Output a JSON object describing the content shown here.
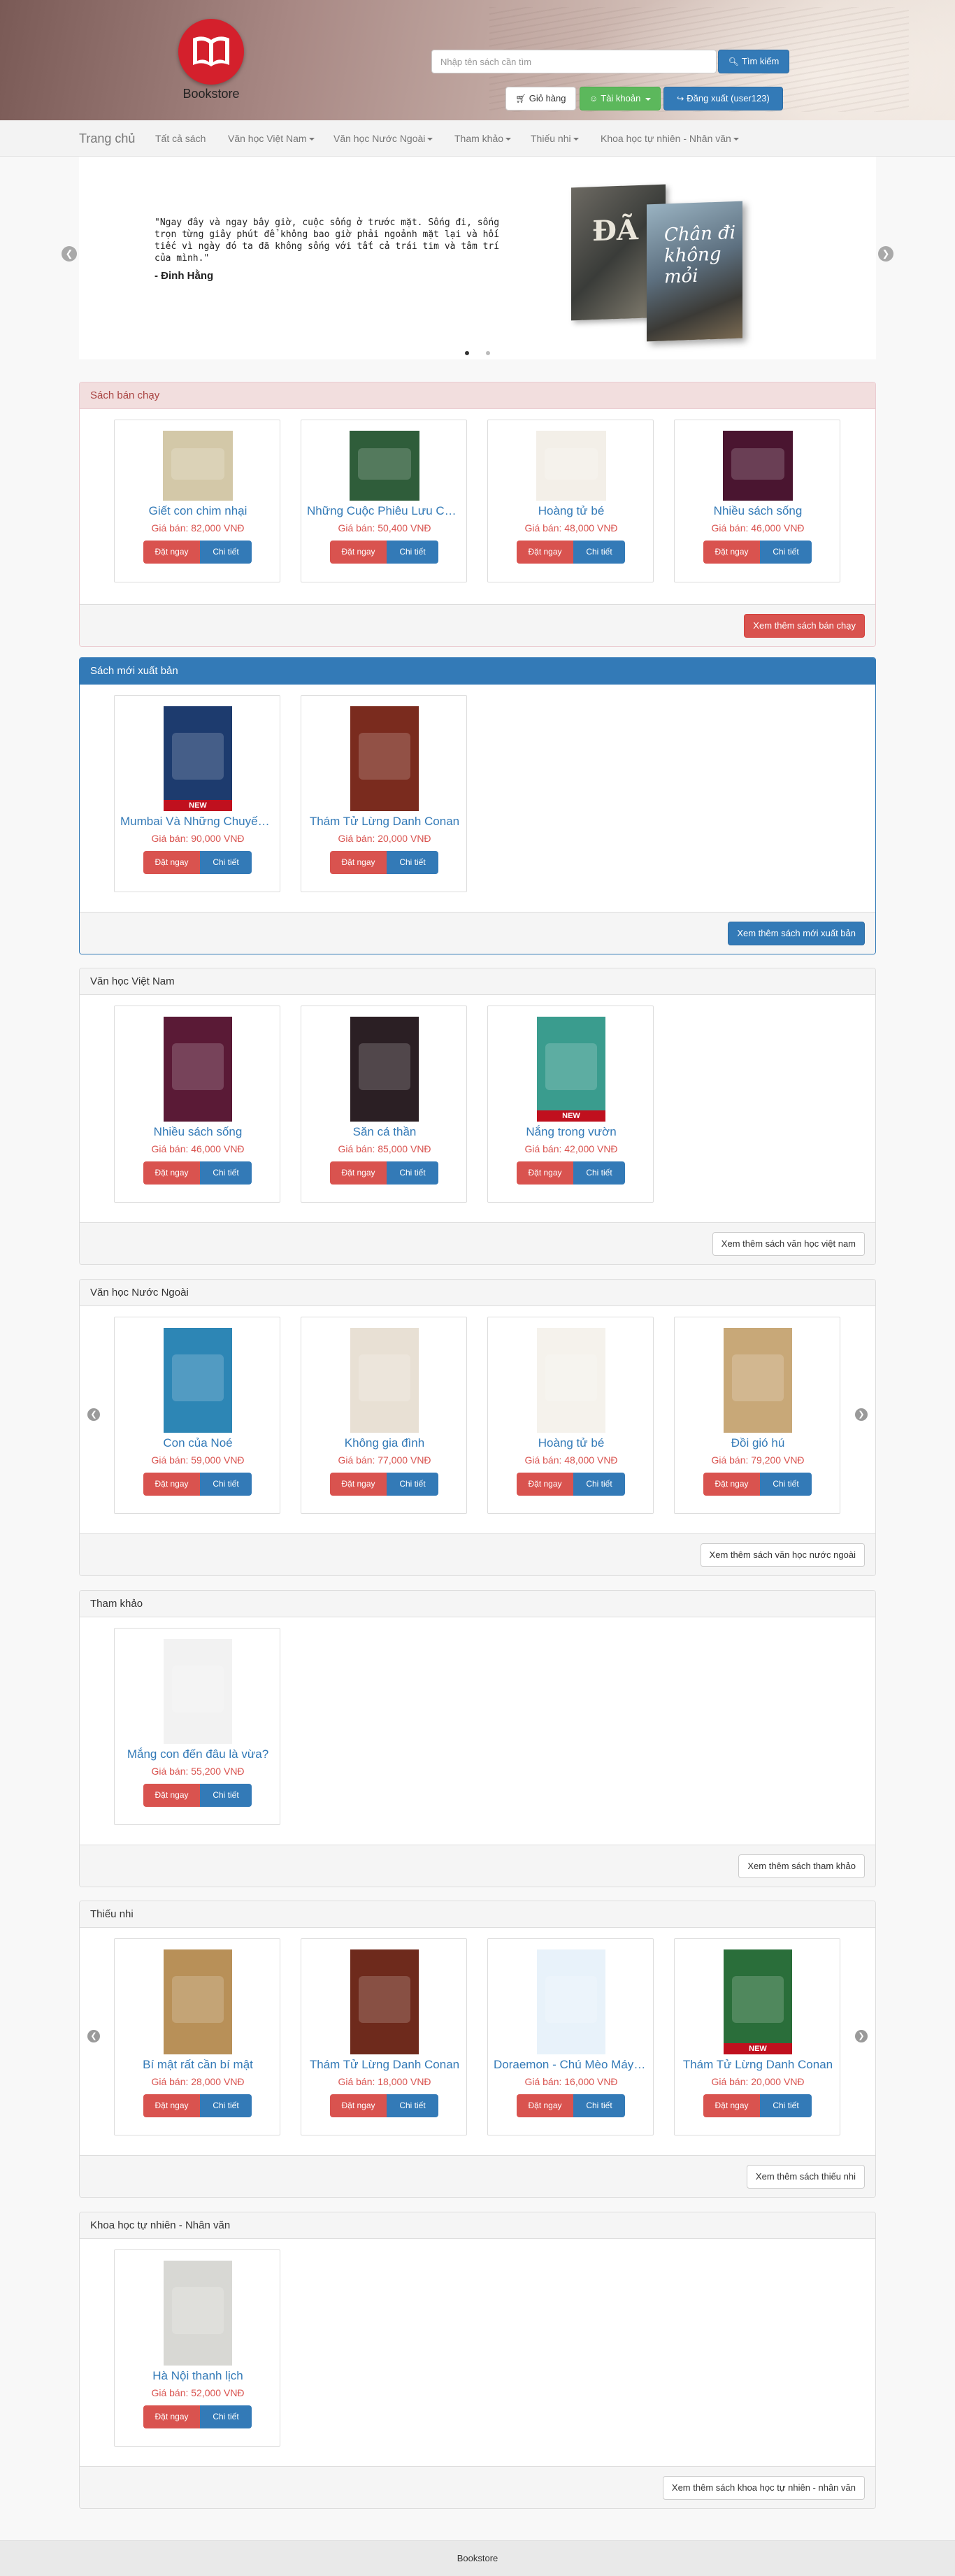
{
  "brand": {
    "name": "Bookstore"
  },
  "header": {
    "search_placeholder": "Nhập tên sách cần tìm",
    "search_button": "Tìm kiếm",
    "cart_button": "Giỏ hàng",
    "account_button": "Tài khoản",
    "logout_button": "Đăng xuất (user123)"
  },
  "nav": {
    "home": "Trang chủ",
    "items": [
      {
        "label": "Tất cả sách",
        "dropdown": false
      },
      {
        "label": "Văn học Việt Nam",
        "dropdown": true
      },
      {
        "label": "Văn học Nước Ngoài",
        "dropdown": true
      },
      {
        "label": "Tham khảo",
        "dropdown": true
      },
      {
        "label": "Thiếu nhi",
        "dropdown": true
      },
      {
        "label": "Khoa học tự nhiên - Nhân văn",
        "dropdown": true
      }
    ]
  },
  "carousel": {
    "quote": "\"Ngay đây và ngay bây giờ, cuộc sống ở trước mặt. Sống đi, sống trọn từng giây phút để không bao giờ phải ngoảnh mặt lại và hối tiếc vì ngày đó ta đã không sống với tất cả trái tim và tâm trí của mình.\"",
    "author": "- Đinh Hằng",
    "book1_title": "ĐÃ",
    "book2_title": "Chân đi không mỏi",
    "slides": 2,
    "active_slide": 1
  },
  "sections": [
    {
      "title": "Sách bán chạy",
      "style": "danger",
      "more": "Xem thêm sách bán chạy",
      "arrows": false,
      "books": [
        {
          "title": "Giết con chim nhại",
          "price": "Giá bán: 82,000 VNĐ",
          "cover": "#d3c8a8",
          "new": false,
          "tall": false
        },
        {
          "title": "Những Cuộc Phiêu Lưu Của Huckleberry Finn",
          "price": "Giá bán: 50,400 VNĐ",
          "cover": "#2f5d3a",
          "new": false,
          "tall": false
        },
        {
          "title": "Hoàng tử bé",
          "price": "Giá bán: 48,000 VNĐ",
          "cover": "#f3efe8",
          "new": false,
          "tall": false
        },
        {
          "title": "Nhiều sách sống",
          "price": "Giá bán: 46,000 VNĐ",
          "cover": "#4a1530",
          "new": false,
          "tall": false
        }
      ]
    },
    {
      "title": "Sách mới xuất bản",
      "style": "primary",
      "more": "Xem thêm sách mới xuất bản",
      "arrows": false,
      "books": [
        {
          "title": "Mumbai Và Những Chuyến Phiêu Lưu",
          "price": "Giá bán: 90,000 VNĐ",
          "cover": "#1d3b6e",
          "new": true,
          "tall": true
        },
        {
          "title": "Thám Tử Lừng Danh Conan",
          "price": "Giá bán: 20,000 VNĐ",
          "cover": "#7a2b1e",
          "new": false,
          "tall": true
        }
      ]
    },
    {
      "title": "Văn học Việt Nam",
      "style": "default",
      "more": "Xem thêm sách văn học việt nam",
      "arrows": false,
      "books": [
        {
          "title": "Nhiều sách sống",
          "price": "Giá bán: 46,000 VNĐ",
          "cover": "#5a1a36",
          "new": false,
          "tall": true
        },
        {
          "title": "Săn cá thần",
          "price": "Giá bán: 85,000 VNĐ",
          "cover": "#2b1f24",
          "new": false,
          "tall": true
        },
        {
          "title": "Nắng trong vườn",
          "price": "Giá bán: 42,000 VNĐ",
          "cover": "#3a9c8e",
          "new": true,
          "tall": true
        }
      ]
    },
    {
      "title": "Văn học Nước Ngoài",
      "style": "default",
      "more": "Xem thêm sách văn học nước ngoài",
      "arrows": true,
      "books": [
        {
          "title": "Con của Noé",
          "price": "Giá bán: 59,000 VNĐ",
          "cover": "#2d86b5",
          "new": false,
          "tall": true
        },
        {
          "title": "Không gia đình",
          "price": "Giá bán: 77,000 VNĐ",
          "cover": "#e8e0d4",
          "new": false,
          "tall": true
        },
        {
          "title": "Hoàng tử bé",
          "price": "Giá bán: 48,000 VNĐ",
          "cover": "#f5f2ec",
          "new": false,
          "tall": true
        },
        {
          "title": "Đồi gió hú",
          "price": "Giá bán: 79,200 VNĐ",
          "cover": "#c8a878",
          "new": false,
          "tall": true
        }
      ]
    },
    {
      "title": "Tham khảo",
      "style": "default",
      "more": "Xem thêm sách tham khảo",
      "arrows": false,
      "books": [
        {
          "title": "Mắng con đến đâu là vừa?",
          "price": "Giá bán: 55,200 VNĐ",
          "cover": "#f2f2f2",
          "new": false,
          "tall": true
        }
      ]
    },
    {
      "title": "Thiếu nhi",
      "style": "default",
      "more": "Xem thêm sách thiếu nhi",
      "arrows": true,
      "books": [
        {
          "title": "Bí mật rất cần bí mật",
          "price": "Giá bán: 28,000 VNĐ",
          "cover": "#b89058",
          "new": false,
          "tall": true
        },
        {
          "title": "Thám Tử Lừng Danh Conan",
          "price": "Giá bán: 18,000 VNĐ",
          "cover": "#6e2a1c",
          "new": false,
          "tall": true
        },
        {
          "title": "Doraemon - Chú Mèo Máy Đến Từ Tương Lai",
          "price": "Giá bán: 16,000 VNĐ",
          "cover": "#e8f2fa",
          "new": false,
          "tall": true
        },
        {
          "title": "Thám Tử Lừng Danh Conan",
          "price": "Giá bán: 20,000 VNĐ",
          "cover": "#2a6e3a",
          "new": true,
          "tall": true
        }
      ]
    },
    {
      "title": "Khoa học tự nhiên - Nhân văn",
      "style": "default",
      "more": "Xem thêm sách khoa học tự nhiên - nhân văn",
      "arrows": false,
      "books": [
        {
          "title": "Hà Nội thanh lịch",
          "price": "Giá bán: 52,000 VNĐ",
          "cover": "#d8d8d4",
          "new": false,
          "tall": true
        }
      ]
    }
  ],
  "card_buttons": {
    "order": "Đặt ngay",
    "detail": "Chi tiết"
  },
  "footer": {
    "text": "Bookstore"
  },
  "colors": {
    "primary": "#337ab7",
    "danger": "#d9534f",
    "success": "#5cb85c",
    "logo_red": "#d4202c"
  }
}
